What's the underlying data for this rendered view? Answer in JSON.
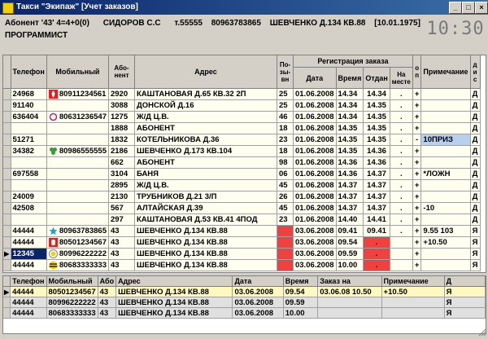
{
  "window": {
    "title": "Такси \"Экипаж\" [Учет заказов]"
  },
  "info": {
    "abonent": "Абонент '43'  4=4+0(0)",
    "person": "СИДОРОВ С.С",
    "phone": "т.55555",
    "mobile": "80963783865",
    "address": "ШЕВЧЕНКО Д.134 КВ.88",
    "date": "[10.01.1975]",
    "profession": "ПРОГРАММИСТ",
    "clock": "10:30"
  },
  "grid1": {
    "headers": {
      "phone": "Телефон",
      "mobile": "Мобильный",
      "abonent": "Або-нент",
      "address": "Адрес",
      "pos": "По-зы-вн",
      "reg": "Регистрация заказа",
      "date": "Дата",
      "time": "Время",
      "sent": "Отдан",
      "on_site": "На месте",
      "op": "о п",
      "note": "Примечание",
      "disp": "д и с"
    },
    "rows": [
      {
        "phone": "24968",
        "icon": "fire",
        "mobile": "80911234561",
        "abonent": "2920",
        "address": "КАШТАНОВАЯ Д.65 КВ.32 2П",
        "pos": "25",
        "date": "01.06.2008",
        "time": "14.34",
        "sent": "14.34",
        "on_site": ".",
        "op": "+",
        "note": "",
        "disp": "Д"
      },
      {
        "phone": "91140",
        "icon": "",
        "mobile": "",
        "abonent": "3088",
        "address": "ДОНСКОЙ Д.16",
        "pos": "25",
        "date": "01.06.2008",
        "time": "14.34",
        "sent": "14.35",
        "on_site": ".",
        "op": "+",
        "note": "",
        "disp": "Д"
      },
      {
        "phone": "636404",
        "icon": "swirl",
        "mobile": "80631236547",
        "abonent": "1275",
        "address": "Ж/Д Ц.В.",
        "pos": "46",
        "date": "01.06.2008",
        "time": "14.34",
        "sent": "14.35",
        "on_site": ".",
        "op": "+",
        "note": "",
        "disp": "Д"
      },
      {
        "phone": "",
        "icon": "",
        "mobile": "",
        "abonent": "1888",
        "address": "АБОНЕНТ",
        "pos": "18",
        "date": "01.06.2008",
        "time": "14.35",
        "sent": "14.35",
        "on_site": ".",
        "op": "+",
        "note": "",
        "disp": "Д"
      },
      {
        "phone": "51271",
        "icon": "",
        "mobile": "",
        "abonent": "1832",
        "address": "КОТЕЛЬНИКОВА Д.36",
        "pos": "23",
        "date": "01.06.2008",
        "time": "14.35",
        "sent": "14.35",
        "on_site": ".",
        "op": "-",
        "note": "10ПРИЗ",
        "disp": "Д",
        "note_blue": true
      },
      {
        "phone": "34382",
        "icon": "clover",
        "mobile": "80986555555",
        "abonent": "2186",
        "address": "ШЕВЧЕНКО Д.173 КВ.104",
        "pos": "18",
        "date": "01.06.2008",
        "time": "14.35",
        "sent": "14.36",
        "on_site": ".",
        "op": "+",
        "note": "",
        "disp": "Д"
      },
      {
        "phone": "",
        "icon": "",
        "mobile": "",
        "abonent": "662",
        "address": "АБОНЕНТ",
        "pos": "98",
        "date": "01.06.2008",
        "time": "14.36",
        "sent": "14.36",
        "on_site": ".",
        "op": "+",
        "note": "",
        "disp": "Д"
      },
      {
        "phone": "697558",
        "icon": "",
        "mobile": "",
        "abonent": "3104",
        "address": "БАНЯ",
        "pos": "06",
        "date": "01.06.2008",
        "time": "14.36",
        "sent": "14.37",
        "on_site": ".",
        "op": "+",
        "note": "*ЛОЖН",
        "disp": "Д"
      },
      {
        "phone": "",
        "icon": "",
        "mobile": "",
        "abonent": "2895",
        "address": "Ж/Д Ц.В.",
        "pos": "45",
        "date": "01.06.2008",
        "time": "14.37",
        "sent": "14.37",
        "on_site": ".",
        "op": "+",
        "note": "",
        "disp": "Д"
      },
      {
        "phone": "24009",
        "icon": "",
        "mobile": "",
        "abonent": "2130",
        "address": "ТРУБНИКОВ Д.21 3/П",
        "pos": "26",
        "date": "01.06.2008",
        "time": "14.37",
        "sent": "14.37",
        "on_site": ".",
        "op": "+",
        "note": "",
        "disp": "Д"
      },
      {
        "phone": "42508",
        "icon": "",
        "mobile": "",
        "abonent": "567",
        "address": "АЛТАЙСКАЯ Д.39",
        "pos": "45",
        "date": "01.06.2008",
        "time": "14.37",
        "sent": "14.37",
        "on_site": ".",
        "op": "+",
        "note": "-10",
        "disp": "Д"
      },
      {
        "phone": "",
        "icon": "",
        "mobile": "",
        "abonent": "297",
        "address": "КАШТАНОВАЯ Д.53 КВ.41 4ПОД",
        "pos": "23",
        "date": "01.06.2008",
        "time": "14.40",
        "sent": "14.41",
        "on_site": ".",
        "op": "+",
        "note": "",
        "disp": "Д"
      },
      {
        "phone": "44444",
        "icon": "star",
        "mobile": "80963783865",
        "abonent": "43",
        "address": "ШЕВЧЕНКО Д.134 КВ.88",
        "pos": "",
        "date": "03.06.2008",
        "time": "09.41",
        "sent": "09.41",
        "on_site": ".",
        "op": "+",
        "note": "9.55 103",
        "disp": "Я",
        "red_pos": true
      },
      {
        "phone": "44444",
        "icon": "mts",
        "mobile": "80501234567",
        "abonent": "43",
        "address": "ШЕВЧЕНКО Д.134 КВ.88",
        "pos": "",
        "date": "03.06.2008",
        "time": "09.54",
        "sent": ".",
        "on_site": "",
        "op": "+",
        "note": "+10.50",
        "disp": "Я",
        "red_pos": true,
        "red_sent": true
      },
      {
        "phone": "12345",
        "icon": "life",
        "mobile": "80996222222",
        "abonent": "43",
        "address": "ШЕВЧЕНКО Д.134 КВ.88",
        "pos": "",
        "date": "03.06.2008",
        "time": "09.59",
        "sent": ".",
        "on_site": "",
        "op": "+",
        "note": "",
        "disp": "Я",
        "red_pos": true,
        "red_sent": true,
        "selected": true
      },
      {
        "phone": "44444",
        "icon": "beeline",
        "mobile": "80683333333",
        "abonent": "43",
        "address": "ШЕВЧЕНКО Д.134 КВ.88",
        "pos": "",
        "date": "03.06.2008",
        "time": "10.00",
        "sent": ".",
        "on_site": "",
        "op": "+",
        "note": "",
        "disp": "Я",
        "red_pos": true,
        "red_sent": true
      }
    ]
  },
  "grid2": {
    "headers": {
      "phone": "Телефон",
      "mobile": "Мобильный",
      "abonent": "Або",
      "address": "Адрес",
      "date": "Дата",
      "time": "Время",
      "order_for": "Заказ на",
      "note": "Примечание",
      "d": "Д"
    },
    "rows": [
      {
        "phone": "44444",
        "mobile": "80501234567",
        "abonent": "43",
        "address": "ШЕВЧЕНКО Д.134 КВ.88",
        "date": "03.06.2008",
        "time": "09.54",
        "order_for": "03.06.08 10.50",
        "note": "+10.50",
        "d": "Я",
        "selected": true
      },
      {
        "phone": "44444",
        "mobile": "80996222222",
        "abonent": "43",
        "address": "ШЕВЧЕНКО Д.134 КВ.88",
        "date": "03.06.2008",
        "time": "09.59",
        "order_for": "",
        "note": "",
        "d": "Я"
      },
      {
        "phone": "44444",
        "mobile": "80683333333",
        "abonent": "43",
        "address": "ШЕВЧЕНКО Д.134 КВ.88",
        "date": "03.06.2008",
        "time": "10.00",
        "order_for": "",
        "note": "",
        "d": "Я"
      }
    ]
  }
}
